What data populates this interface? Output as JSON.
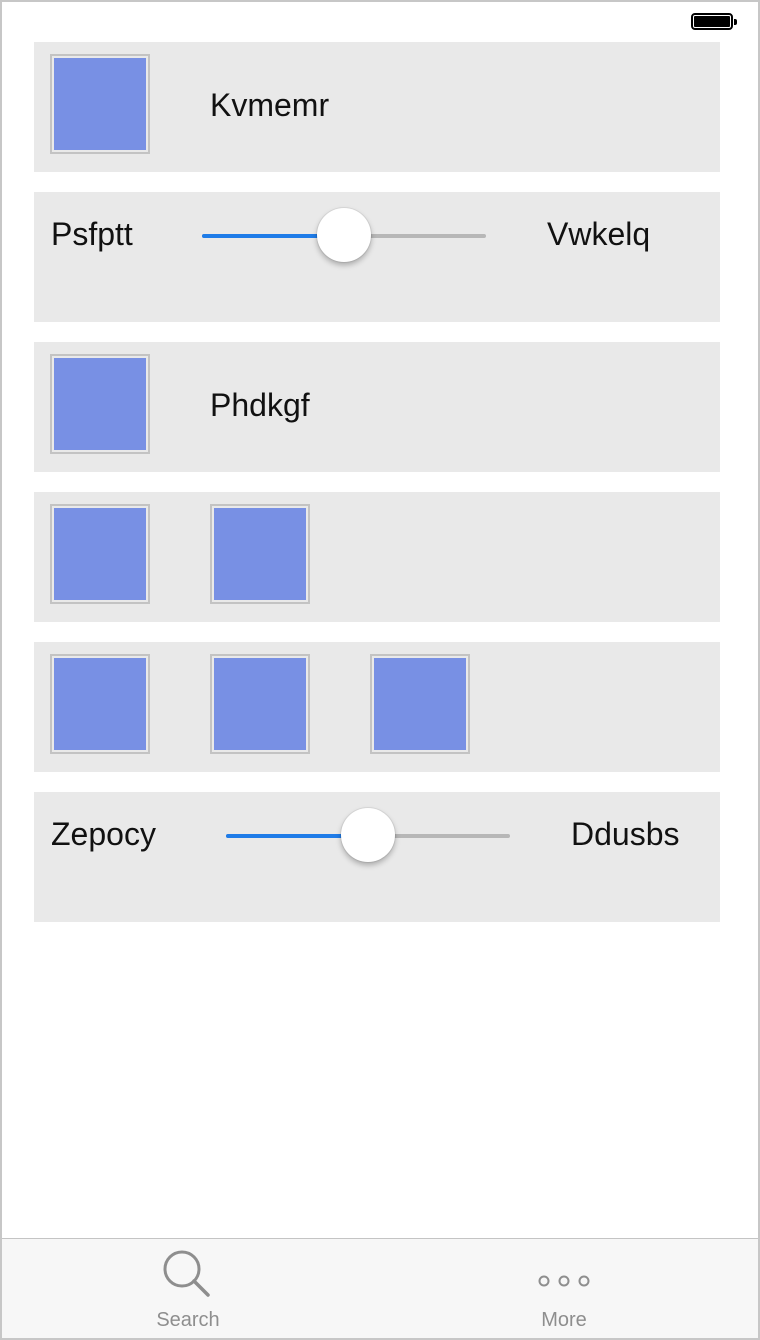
{
  "status_bar": {
    "battery_icon": "battery-full-icon"
  },
  "rows": [
    {
      "type": "tile-label",
      "label": "Kvmemr",
      "tile_color": "#7890e4"
    },
    {
      "type": "slider",
      "left_label": "Psfptt",
      "right_label": "Vwkelq",
      "value": 0.5
    },
    {
      "type": "tile-label",
      "label": "Phdkgf",
      "tile_color": "#7890e4"
    },
    {
      "type": "tiles",
      "count": 2,
      "tile_color": "#7890e4"
    },
    {
      "type": "tiles",
      "count": 3,
      "tile_color": "#7890e4"
    },
    {
      "type": "slider",
      "left_label": "Zepocy",
      "right_label": "Ddusbs",
      "value": 0.5
    }
  ],
  "tab_bar": {
    "tabs": [
      {
        "label": "Search",
        "icon": "search-icon"
      },
      {
        "label": "More",
        "icon": "more-icon"
      }
    ]
  },
  "colors": {
    "slider_accent": "#1f7ce8",
    "row_background": "#e9e9e9",
    "tile_fill": "#7890e4"
  }
}
